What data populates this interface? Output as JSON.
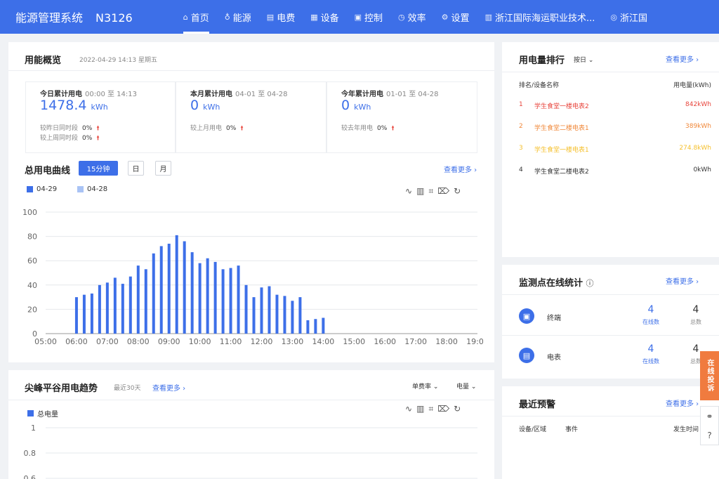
{
  "header": {
    "title": "能源管理系统",
    "code": "N3126",
    "nav": [
      {
        "label": "首页",
        "icon": "home-icon",
        "glyph": "⌂"
      },
      {
        "label": "能源",
        "icon": "bulb-icon",
        "glyph": "♁"
      },
      {
        "label": "电费",
        "icon": "bill-icon",
        "glyph": "▤"
      },
      {
        "label": "设备",
        "icon": "device-icon",
        "glyph": "▦"
      },
      {
        "label": "控制",
        "icon": "control-icon",
        "glyph": "▣"
      },
      {
        "label": "效率",
        "icon": "clock-icon",
        "glyph": "◷"
      },
      {
        "label": "设置",
        "icon": "gear-icon",
        "glyph": "⚙"
      },
      {
        "label": "浙江国际海运职业技术...",
        "icon": "building-icon",
        "glyph": "▥"
      },
      {
        "label": "浙江国",
        "icon": "user-icon",
        "glyph": "◎"
      }
    ]
  },
  "overview": {
    "title": "用能概览",
    "datetime": "2022-04-29 14:13 星期五",
    "today": {
      "label": "今日累计用电",
      "range": "00:00 至 14:13",
      "value": "1478.4",
      "unit": "kWh",
      "cmp1_label": "较昨日同时段",
      "cmp1_value": "0%",
      "cmp2_label": "较上周同时段",
      "cmp2_value": "0%"
    },
    "month": {
      "label": "本月累计用电",
      "range": "04-01 至 04-28",
      "value": "0",
      "unit": "kWh",
      "cmp1_label": "较上月用电",
      "cmp1_value": "0%"
    },
    "year": {
      "label": "今年累计用电",
      "range": "01-01 至 04-28",
      "value": "0",
      "unit": "kWh",
      "cmp1_label": "较去年用电",
      "cmp1_value": "0%"
    }
  },
  "curve": {
    "title": "总用电曲线",
    "buttons": [
      "15分钟",
      "日",
      "月"
    ],
    "more": "查看更多 ›"
  },
  "chart_data": [
    {
      "type": "bar",
      "title": "",
      "legend": "top-left",
      "grid": true,
      "series": [
        {
          "name": "04-29",
          "color": "#3d6fe8",
          "x": [
            "06:00",
            "06:15",
            "06:30",
            "06:45",
            "07:00",
            "07:15",
            "07:30",
            "07:45",
            "08:00",
            "08:15",
            "08:30",
            "08:45",
            "09:00",
            "09:15",
            "09:30",
            "09:45",
            "10:00",
            "10:15",
            "10:30",
            "10:45",
            "11:00",
            "11:15",
            "11:30",
            "11:45",
            "12:00",
            "12:15",
            "12:30",
            "12:45",
            "13:00",
            "13:15",
            "13:30",
            "13:45",
            "14:00"
          ],
          "values": [
            30,
            32,
            33,
            40,
            42,
            46,
            41,
            47,
            56,
            53,
            66,
            72,
            74,
            81,
            76,
            67,
            58,
            62,
            59,
            53,
            54,
            56,
            40,
            30,
            38,
            39,
            32,
            31,
            27,
            30,
            11,
            12,
            13
          ]
        },
        {
          "name": "04-28",
          "color": "#a9c3f5",
          "x": [],
          "values": []
        }
      ],
      "xticks": [
        "05:00",
        "06:00",
        "07:00",
        "08:00",
        "09:00",
        "10:00",
        "11:00",
        "12:00",
        "13:00",
        "14:00",
        "15:00",
        "16:00",
        "17:00",
        "18:00",
        "19:00"
      ],
      "yticks": [
        0,
        20,
        40,
        60,
        80,
        100
      ],
      "ylim": [
        0,
        100
      ]
    },
    {
      "type": "line",
      "title": "",
      "legend": "top-left",
      "grid": true,
      "series": [
        {
          "name": "总电量",
          "color": "#3d6fe8",
          "values": []
        }
      ],
      "yticks": [
        "1",
        "0.8",
        "0.6"
      ]
    }
  ],
  "peak": {
    "title": "尖峰平谷用电趋势",
    "period": "最近30天",
    "more": "查看更多 ›",
    "dropdown1": "单费率",
    "dropdown2": "电量"
  },
  "ranking": {
    "title": "用电量排行",
    "period": "按日",
    "more": "查看更多 ›",
    "col1": "排名/设备名称",
    "col2": "用电量(kWh)",
    "rows": [
      {
        "rank": "1",
        "name": "学生食堂一楼电表2",
        "value": "842kWh",
        "color": "#e8453c"
      },
      {
        "rank": "2",
        "name": "学生食堂二楼电表1",
        "value": "389kWh",
        "color": "#f0883a"
      },
      {
        "rank": "3",
        "name": "学生食堂一楼电表1",
        "value": "274.8kWh",
        "color": "#f5c02e"
      },
      {
        "rank": "4",
        "name": "学生食堂二楼电表2",
        "value": "0kWh",
        "color": "#333333"
      }
    ]
  },
  "online": {
    "title": "监测点在线统计",
    "more": "查看更多 ›",
    "rows": [
      {
        "name": "终端",
        "online": "4",
        "online_label": "在线数",
        "total": "4",
        "total_label": "总数"
      },
      {
        "name": "电表",
        "online": "4",
        "online_label": "在线数",
        "total": "4",
        "total_label": "总数"
      }
    ]
  },
  "alerts": {
    "title": "最近预警",
    "more": "查看更多 ›",
    "col1": "设备/区域",
    "col2": "事件",
    "col3": "发生时间"
  },
  "floating": {
    "chat": "在线投诉"
  }
}
